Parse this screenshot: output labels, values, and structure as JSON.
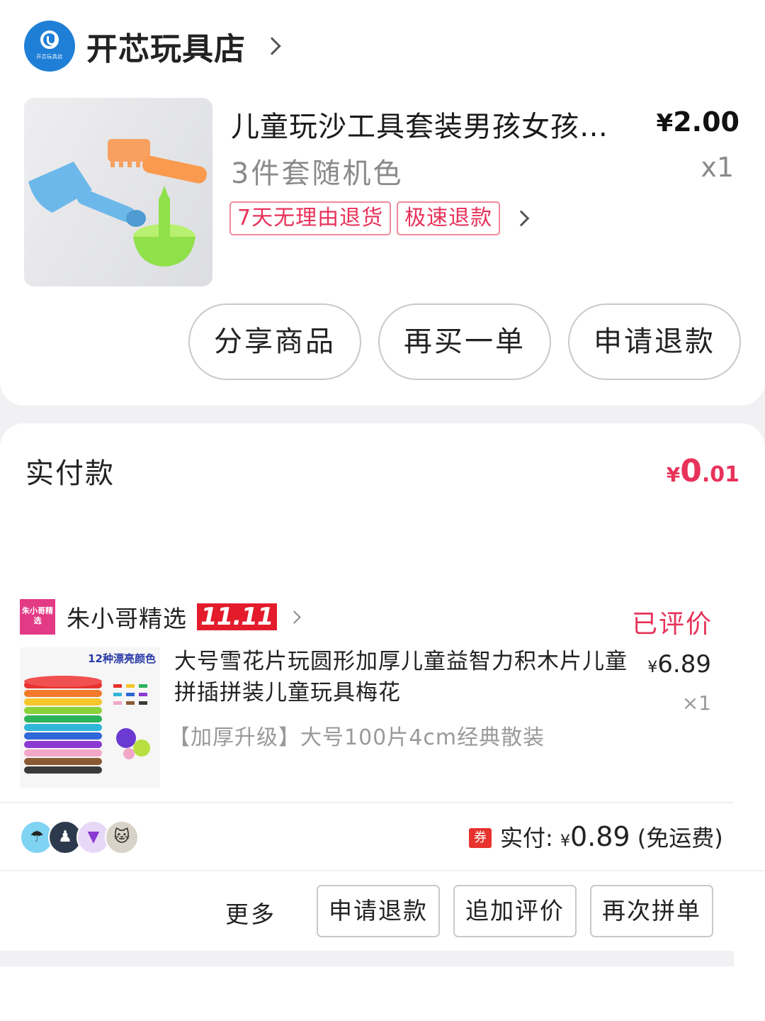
{
  "order1": {
    "shop_name": "开芯玩具店",
    "shop_logo_text": "开芯玩具店",
    "product_title": "儿童玩沙工具套装男孩女孩…",
    "price_symbol": "¥",
    "price_int": "2",
    "price_dec": ".00",
    "spec": "3件套随机色",
    "qty": "x1",
    "tags": [
      "7天无理由退货",
      "极速退款"
    ],
    "buttons": {
      "share": "分享商品",
      "rebuy": "再买一单",
      "refund": "申请退款"
    }
  },
  "payment": {
    "label": "实付款",
    "symbol": "¥",
    "int": "0",
    "dec": ".01"
  },
  "order2": {
    "shop_logo_text": "朱小哥精选",
    "shop_name": "朱小哥精选",
    "badge": "11.11",
    "status": "已评价",
    "image_caption": "12种漂亮颜色",
    "product_title": "大号雪花片玩圆形加厚儿童益智力积木片儿童拼插拼装儿童玩具梅花",
    "price_symbol": "¥",
    "price": "6.89",
    "qty": "×1",
    "spec": "【加厚升级】大号100片4cm经典散装",
    "coupon": "券",
    "actual_label": "实付:",
    "actual_symbol": "¥",
    "actual_amount": "0.89",
    "shipping": "(免运费)",
    "more": "更多",
    "buttons": {
      "refund": "申请退款",
      "add_review": "追加评价",
      "regroup": "再次拼单"
    }
  },
  "colors": {
    "accent": "#e8325a",
    "badge_red": "#e31b2b",
    "shop_blue": "#1f7fd6",
    "shop2_pink": "#e33a86"
  }
}
